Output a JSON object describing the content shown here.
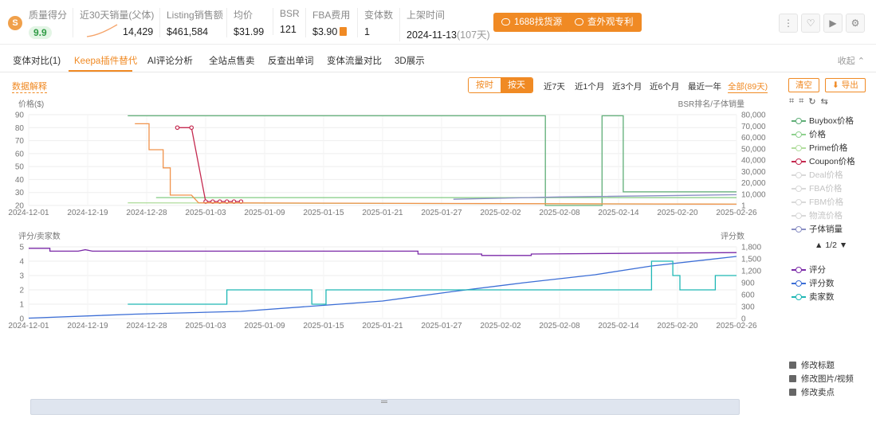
{
  "metrics": {
    "quality_label": "质量得分",
    "quality_value": "9.9",
    "sales_label": "近30天销量(父体)",
    "sales_value": "14,429",
    "revenue_label": "Listing销售额",
    "revenue_value": "$461,584",
    "price_label": "均价",
    "price_value": "$31.99",
    "bsr_label": "BSR",
    "bsr_value": "121",
    "fba_label": "FBA费用",
    "fba_value": "$3.90",
    "variants_label": "变体数",
    "variants_value": "1",
    "listed_label": "上架时间",
    "listed_value": "2024-11-13",
    "listed_age": "(107天)",
    "source_btn": "1688找货源",
    "patent_btn": "查外观专利"
  },
  "tabs": [
    "变体对比(1)",
    "Keepa插件替代",
    "AI评论分析",
    "全站点售卖",
    "反查出单词",
    "变体流量对比",
    "3D展示"
  ],
  "collapse_label": "收起",
  "toolbar": {
    "data_explain": "数据解释",
    "by_hour": "按时",
    "by_day": "按天",
    "ranges": [
      "近7天",
      "近1个月",
      "近3个月",
      "近6个月",
      "最近一年",
      "全部(89天)"
    ],
    "clear": "清空",
    "export": "导出"
  },
  "legend_top": [
    {
      "label": "Buybox价格",
      "color": "#5fae77",
      "active": true
    },
    {
      "label": "价格",
      "color": "#8fd08f",
      "active": true
    },
    {
      "label": "Prime价格",
      "color": "#b3dea0",
      "active": true
    },
    {
      "label": "Coupon价格",
      "color": "#c4294f",
      "active": true
    },
    {
      "label": "Deal价格",
      "color": "#d9d9d9",
      "active": false
    },
    {
      "label": "FBA价格",
      "color": "#d9d9d9",
      "active": false
    },
    {
      "label": "FBM价格",
      "color": "#d9d9d9",
      "active": false
    },
    {
      "label": "物流价格",
      "color": "#d9d9d9",
      "active": false
    },
    {
      "label": "子体销量",
      "color": "#8a8fc4",
      "active": true
    }
  ],
  "legend_pager": "1/2",
  "legend_bottom": [
    {
      "label": "评分",
      "color": "#7b2aa8",
      "active": true
    },
    {
      "label": "评分数",
      "color": "#3c6ed6",
      "active": true
    },
    {
      "label": "卖家数",
      "color": "#1fb7b5",
      "active": true
    }
  ],
  "actions": [
    "修改标题",
    "修改图片/视频",
    "修改卖点"
  ],
  "chart_data": [
    {
      "type": "line",
      "ylabel": "价格($)",
      "y2label": "BSR排名/子体销量",
      "ylim": [
        20,
        90
      ],
      "yticks": [
        20,
        30,
        40,
        50,
        60,
        70,
        80,
        90
      ],
      "y2lim": [
        0,
        80000
      ],
      "y2ticks": [
        "1",
        "10,000",
        "20,000",
        "30,000",
        "40,000",
        "50,000",
        "60,000",
        "70,000",
        "80,000"
      ],
      "xticks": [
        "2024-12-01",
        "2024-12-19",
        "2024-12-28",
        "2025-01-03",
        "2025-01-09",
        "2025-01-15",
        "2025-01-21",
        "2025-01-27",
        "2025-02-02",
        "2025-02-08",
        "2025-02-14",
        "2025-02-20",
        "2025-02-26"
      ],
      "grid": true,
      "series": [
        {
          "name": "Buybox价格",
          "axis": "y2",
          "points": [
            [
              0.14,
              79000
            ],
            [
              0.73,
              79000
            ],
            [
              0.73,
              1
            ],
            [
              0.81,
              1
            ],
            [
              0.81,
              79000
            ],
            [
              0.84,
              79000
            ],
            [
              0.84,
              12000
            ],
            [
              1.0,
              12000
            ]
          ]
        },
        {
          "name": "价格",
          "axis": "y",
          "points": [
            [
              0.18,
              26
            ],
            [
              1.0,
              26
            ]
          ]
        },
        {
          "name": "Prime价格",
          "axis": "y",
          "points": [
            [
              0.14,
              22
            ],
            [
              1.0,
              21
            ]
          ]
        },
        {
          "name": "Coupon价格",
          "axis": "y",
          "points": [
            [
              0.21,
              80
            ],
            [
              0.23,
              80
            ],
            [
              0.25,
              23
            ],
            [
              0.3,
              23
            ]
          ]
        },
        {
          "name": "子体销量",
          "axis": "y2",
          "points": [
            [
              0.6,
              5500
            ],
            [
              0.75,
              7500
            ],
            [
              1.0,
              9500
            ]
          ]
        },
        {
          "name": "排名",
          "axis": "y",
          "points": [
            [
              0.15,
              83
            ],
            [
              0.17,
              83
            ],
            [
              0.17,
              63
            ],
            [
              0.19,
              63
            ],
            [
              0.19,
              49
            ],
            [
              0.2,
              49
            ],
            [
              0.2,
              28
            ],
            [
              0.23,
              28
            ],
            [
              0.24,
              22
            ],
            [
              1.0,
              21
            ]
          ]
        }
      ]
    },
    {
      "type": "line",
      "ylabel": "评分/卖家数",
      "y2label": "评分数",
      "ylim": [
        0,
        5
      ],
      "yticks": [
        0,
        1,
        2,
        3,
        4,
        5
      ],
      "y2lim": [
        0,
        1800
      ],
      "y2ticks": [
        "0",
        "300",
        "600",
        "900",
        "1,200",
        "1,500",
        "1,800"
      ],
      "xticks": [
        "2024-12-01",
        "2024-12-19",
        "2024-12-28",
        "2025-01-03",
        "2025-01-09",
        "2025-01-15",
        "2025-01-21",
        "2025-01-27",
        "2025-02-02",
        "2025-02-08",
        "2025-02-14",
        "2025-02-20",
        "2025-02-26"
      ],
      "grid": true,
      "series": [
        {
          "name": "评分",
          "axis": "y",
          "points": [
            [
              0.0,
              4.9
            ],
            [
              0.03,
              4.9
            ],
            [
              0.03,
              4.7
            ],
            [
              0.07,
              4.7
            ],
            [
              0.08,
              4.8
            ],
            [
              0.09,
              4.7
            ],
            [
              0.55,
              4.7
            ],
            [
              0.55,
              4.5
            ],
            [
              0.64,
              4.5
            ],
            [
              0.64,
              4.4
            ],
            [
              0.71,
              4.4
            ],
            [
              0.71,
              4.5
            ],
            [
              1.0,
              4.6
            ]
          ]
        },
        {
          "name": "评分数",
          "axis": "y2",
          "points": [
            [
              0.0,
              10
            ],
            [
              0.15,
              110
            ],
            [
              0.3,
              180
            ],
            [
              0.4,
              310
            ],
            [
              0.5,
              440
            ],
            [
              0.6,
              680
            ],
            [
              0.7,
              900
            ],
            [
              0.8,
              1100
            ],
            [
              0.88,
              1320
            ],
            [
              1.0,
              1560
            ]
          ]
        },
        {
          "name": "卖家数",
          "axis": "y",
          "points": [
            [
              0.14,
              1
            ],
            [
              0.28,
              1
            ],
            [
              0.28,
              2
            ],
            [
              0.4,
              2
            ],
            [
              0.4,
              1
            ],
            [
              0.42,
              1
            ],
            [
              0.42,
              2
            ],
            [
              0.88,
              2
            ],
            [
              0.88,
              4
            ],
            [
              0.91,
              4
            ],
            [
              0.91,
              3
            ],
            [
              0.92,
              3
            ],
            [
              0.92,
              2
            ],
            [
              0.97,
              2
            ],
            [
              0.97,
              3
            ],
            [
              1.0,
              3
            ]
          ]
        }
      ]
    }
  ]
}
